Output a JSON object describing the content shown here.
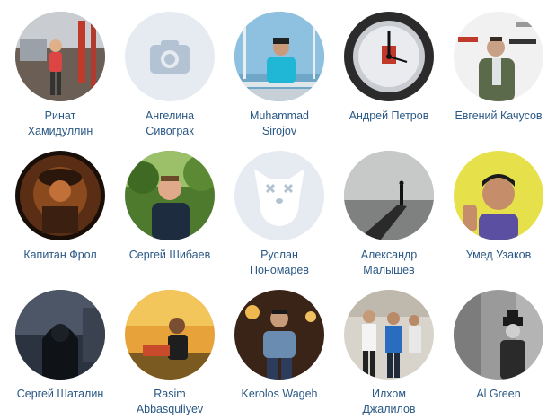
{
  "colors": {
    "link": "#2a5885",
    "placeholder_bg": "#e5ebf1",
    "placeholder_icon": "#b3c3d3"
  },
  "friends": [
    {
      "lines": [
        "Ринат",
        "Хамидуллин"
      ],
      "avatar": "gym-photo"
    },
    {
      "lines": [
        "Ангелина",
        "Сивограк"
      ],
      "avatar": "camera-placeholder-icon"
    },
    {
      "lines": [
        "Muhammad",
        "Sirojov"
      ],
      "avatar": "window-photo"
    },
    {
      "lines": [
        "Андрей Петров"
      ],
      "avatar": "clock-photo"
    },
    {
      "lines": [
        "Евгений Качусов"
      ],
      "avatar": "press-wall-photo"
    },
    {
      "lines": [
        "Капитан Фрол"
      ],
      "avatar": "dark-art-photo"
    },
    {
      "lines": [
        "Сергей Шибаев"
      ],
      "avatar": "park-photo"
    },
    {
      "lines": [
        "Руслан",
        "Пономарев"
      ],
      "avatar": "deleted-dog-icon"
    },
    {
      "lines": [
        "Александр",
        "Малышев"
      ],
      "avatar": "pier-photo"
    },
    {
      "lines": [
        "Умед Узаков"
      ],
      "avatar": "yellow-selfie-photo"
    },
    {
      "lines": [
        "Сергей Шаталин"
      ],
      "avatar": "hooded-figure-photo"
    },
    {
      "lines": [
        "Rasim",
        "Abbasquliyev"
      ],
      "avatar": "sunset-photo"
    },
    {
      "lines": [
        "Kerolos Wageh"
      ],
      "avatar": "night-street-photo"
    },
    {
      "lines": [
        "Илхом",
        "Джалилов"
      ],
      "avatar": "group-photo"
    },
    {
      "lines": [
        "Al Green"
      ],
      "avatar": "bw-man-photo"
    }
  ]
}
